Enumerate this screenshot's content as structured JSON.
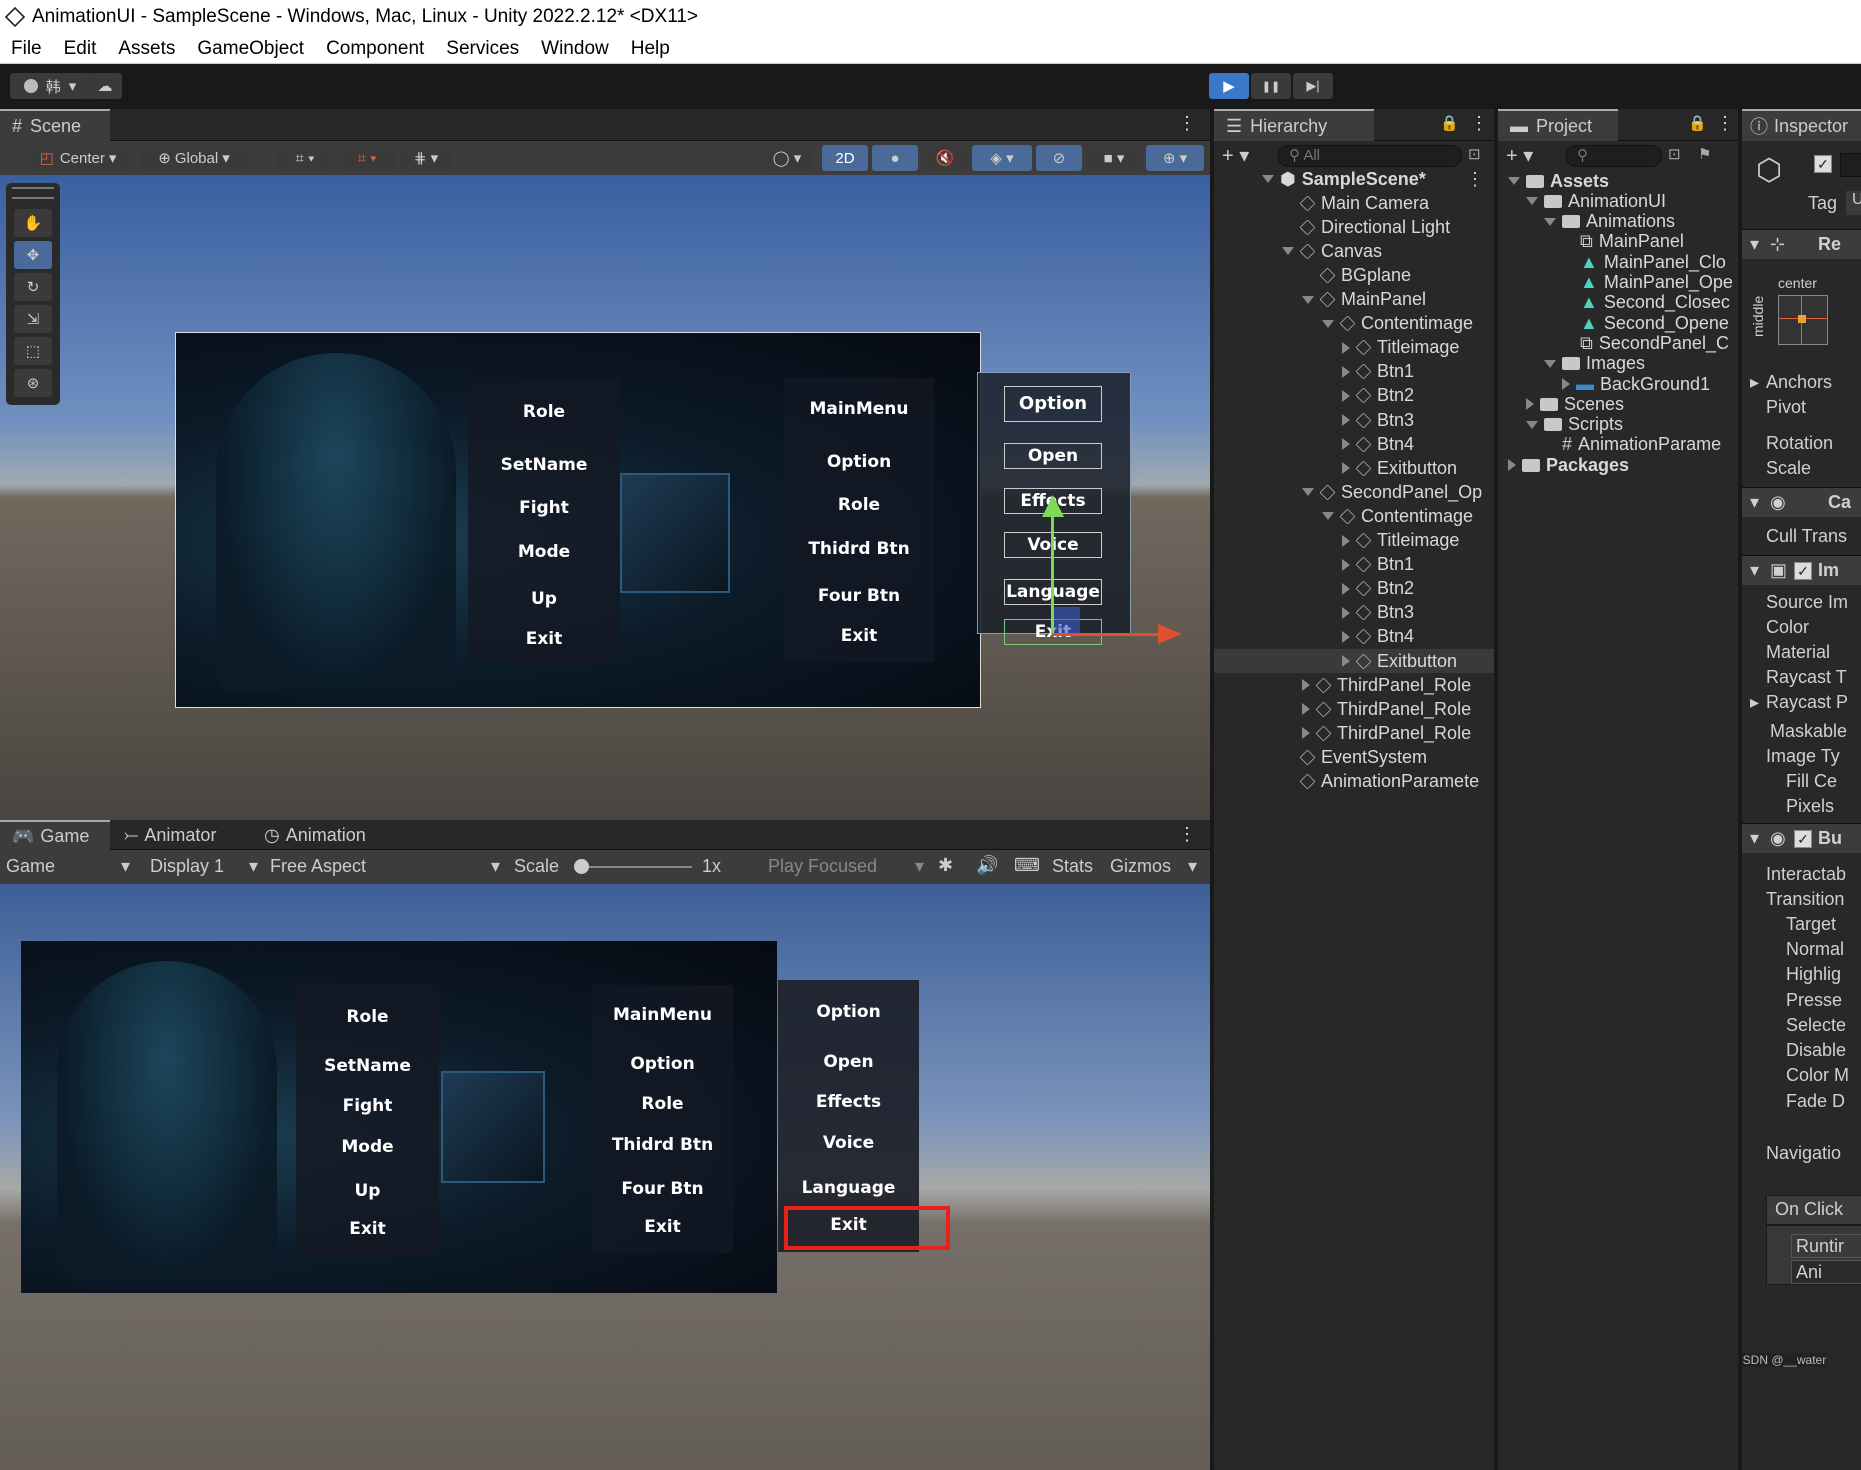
{
  "window": {
    "title": "AnimationUI - SampleScene - Windows, Mac, Linux - Unity 2022.2.12* <DX11>"
  },
  "menu": [
    "File",
    "Edit",
    "Assets",
    "GameObject",
    "Component",
    "Services",
    "Window",
    "Help"
  ],
  "toolbar": {
    "account": "韩",
    "play": "▶",
    "pause": "❚❚",
    "step": "▶|"
  },
  "scene": {
    "tab": "Scene",
    "pivot": "Center",
    "space": "Global",
    "mode2d": "2D"
  },
  "scene_ui": {
    "left_menu": [
      "Role",
      "SetName",
      "Fight",
      "Mode",
      "Up",
      "Exit"
    ],
    "mid_menu": [
      "MainMenu",
      "Option",
      "Role",
      "Thidrd Btn",
      "Four Btn",
      "Exit"
    ],
    "option_menu": [
      "Option",
      "Open",
      "Effects",
      "Voice",
      "Language",
      "Exit"
    ]
  },
  "game": {
    "tabs": [
      "Game",
      "Animator",
      "Animation"
    ],
    "mode": "Game",
    "display": "Display 1",
    "aspect": "Free Aspect",
    "scale_label": "Scale",
    "scale_value": "1x",
    "play_focused": "Play Focused",
    "stats": "Stats",
    "gizmos": "Gizmos"
  },
  "hierarchy": {
    "tab": "Hierarchy",
    "search": "All",
    "items": [
      {
        "label": "SampleScene*",
        "indent": 0,
        "arrow": "down",
        "icon": "unity"
      },
      {
        "label": "Main Camera",
        "indent": 1,
        "arrow": "",
        "icon": "cube"
      },
      {
        "label": "Directional Light",
        "indent": 1,
        "arrow": "",
        "icon": "cube"
      },
      {
        "label": "Canvas",
        "indent": 1,
        "arrow": "down",
        "icon": "cube"
      },
      {
        "label": "BGplane",
        "indent": 2,
        "arrow": "",
        "icon": "cube"
      },
      {
        "label": "MainPanel",
        "indent": 2,
        "arrow": "down",
        "icon": "cube"
      },
      {
        "label": "Contentimage",
        "indent": 3,
        "arrow": "down",
        "icon": "cube"
      },
      {
        "label": "Titleimage",
        "indent": 4,
        "arrow": "right",
        "icon": "cube"
      },
      {
        "label": "Btn1",
        "indent": 4,
        "arrow": "right",
        "icon": "cube"
      },
      {
        "label": "Btn2",
        "indent": 4,
        "arrow": "right",
        "icon": "cube"
      },
      {
        "label": "Btn3",
        "indent": 4,
        "arrow": "right",
        "icon": "cube"
      },
      {
        "label": "Btn4",
        "indent": 4,
        "arrow": "right",
        "icon": "cube"
      },
      {
        "label": "Exitbutton",
        "indent": 4,
        "arrow": "right",
        "icon": "cube"
      },
      {
        "label": "SecondPanel_Op",
        "indent": 2,
        "arrow": "down",
        "icon": "cube"
      },
      {
        "label": "Contentimage",
        "indent": 3,
        "arrow": "down",
        "icon": "cube"
      },
      {
        "label": "Titleimage",
        "indent": 4,
        "arrow": "right",
        "icon": "cube"
      },
      {
        "label": "Btn1",
        "indent": 4,
        "arrow": "right",
        "icon": "cube"
      },
      {
        "label": "Btn2",
        "indent": 4,
        "arrow": "right",
        "icon": "cube"
      },
      {
        "label": "Btn3",
        "indent": 4,
        "arrow": "right",
        "icon": "cube"
      },
      {
        "label": "Btn4",
        "indent": 4,
        "arrow": "right",
        "icon": "cube"
      },
      {
        "label": "Exitbutton",
        "indent": 4,
        "arrow": "right",
        "icon": "cube",
        "selected": true
      },
      {
        "label": "ThirdPanel_Role",
        "indent": 2,
        "arrow": "right",
        "icon": "cube"
      },
      {
        "label": "ThirdPanel_Role",
        "indent": 2,
        "arrow": "right",
        "icon": "cube"
      },
      {
        "label": "ThirdPanel_Role",
        "indent": 2,
        "arrow": "right",
        "icon": "cube"
      },
      {
        "label": "EventSystem",
        "indent": 1,
        "arrow": "",
        "icon": "cube"
      },
      {
        "label": "AnimationParamete",
        "indent": 1,
        "arrow": "",
        "icon": "cube"
      }
    ]
  },
  "project": {
    "tab": "Project",
    "items": [
      {
        "label": "Assets",
        "indent": 0,
        "arrow": "down",
        "icon": "folder",
        "bold": true
      },
      {
        "label": "AnimationUI",
        "indent": 1,
        "arrow": "down",
        "icon": "folder"
      },
      {
        "label": "Animations",
        "indent": 2,
        "arrow": "down",
        "icon": "folder"
      },
      {
        "label": "MainPanel",
        "indent": 3,
        "arrow": "",
        "icon": "controller"
      },
      {
        "label": "MainPanel_Clo",
        "indent": 3,
        "arrow": "",
        "icon": "anim"
      },
      {
        "label": "MainPanel_Ope",
        "indent": 3,
        "arrow": "",
        "icon": "anim"
      },
      {
        "label": "Second_Closec",
        "indent": 3,
        "arrow": "",
        "icon": "anim"
      },
      {
        "label": "Second_Opene",
        "indent": 3,
        "arrow": "",
        "icon": "anim"
      },
      {
        "label": "SecondPanel_C",
        "indent": 3,
        "arrow": "",
        "icon": "controller"
      },
      {
        "label": "Images",
        "indent": 2,
        "arrow": "down",
        "icon": "folder"
      },
      {
        "label": "BackGround1",
        "indent": 3,
        "arrow": "right",
        "icon": "image"
      },
      {
        "label": "Scenes",
        "indent": 1,
        "arrow": "right",
        "icon": "folder"
      },
      {
        "label": "Scripts",
        "indent": 1,
        "arrow": "down",
        "icon": "folder"
      },
      {
        "label": "AnimationParame",
        "indent": 2,
        "arrow": "",
        "icon": "script"
      },
      {
        "label": "Packages",
        "indent": 0,
        "arrow": "right",
        "icon": "folder",
        "bold": true
      }
    ]
  },
  "inspector": {
    "tab": "Inspector",
    "tag": "Tag",
    "tag_value": "U",
    "rect_header": "Re",
    "anchor_center": "center",
    "anchor_middle": "middle",
    "rect_rows": [
      "Anchors",
      "Pivot",
      "Rotation",
      "Scale"
    ],
    "canvas_header": "Ca",
    "cull": "Cull Trans",
    "image_header": "Im",
    "image_rows": [
      "Source Im",
      "Color",
      "Material",
      "Raycast T",
      "Raycast P",
      "Maskable",
      "Image Ty",
      "Fill Ce",
      "Pixels"
    ],
    "button_header": "Bu",
    "button_rows": [
      "Interactab",
      "Transition",
      "Target",
      "Normal",
      "Highlig",
      "Presse",
      "Selecte",
      "Disable",
      "Color M",
      "Fade D"
    ],
    "navigation": "Navigatio",
    "onclick": "On Click",
    "runtime": "Runtir",
    "ani": "Ani",
    "watermark": "CSDN @__water"
  }
}
